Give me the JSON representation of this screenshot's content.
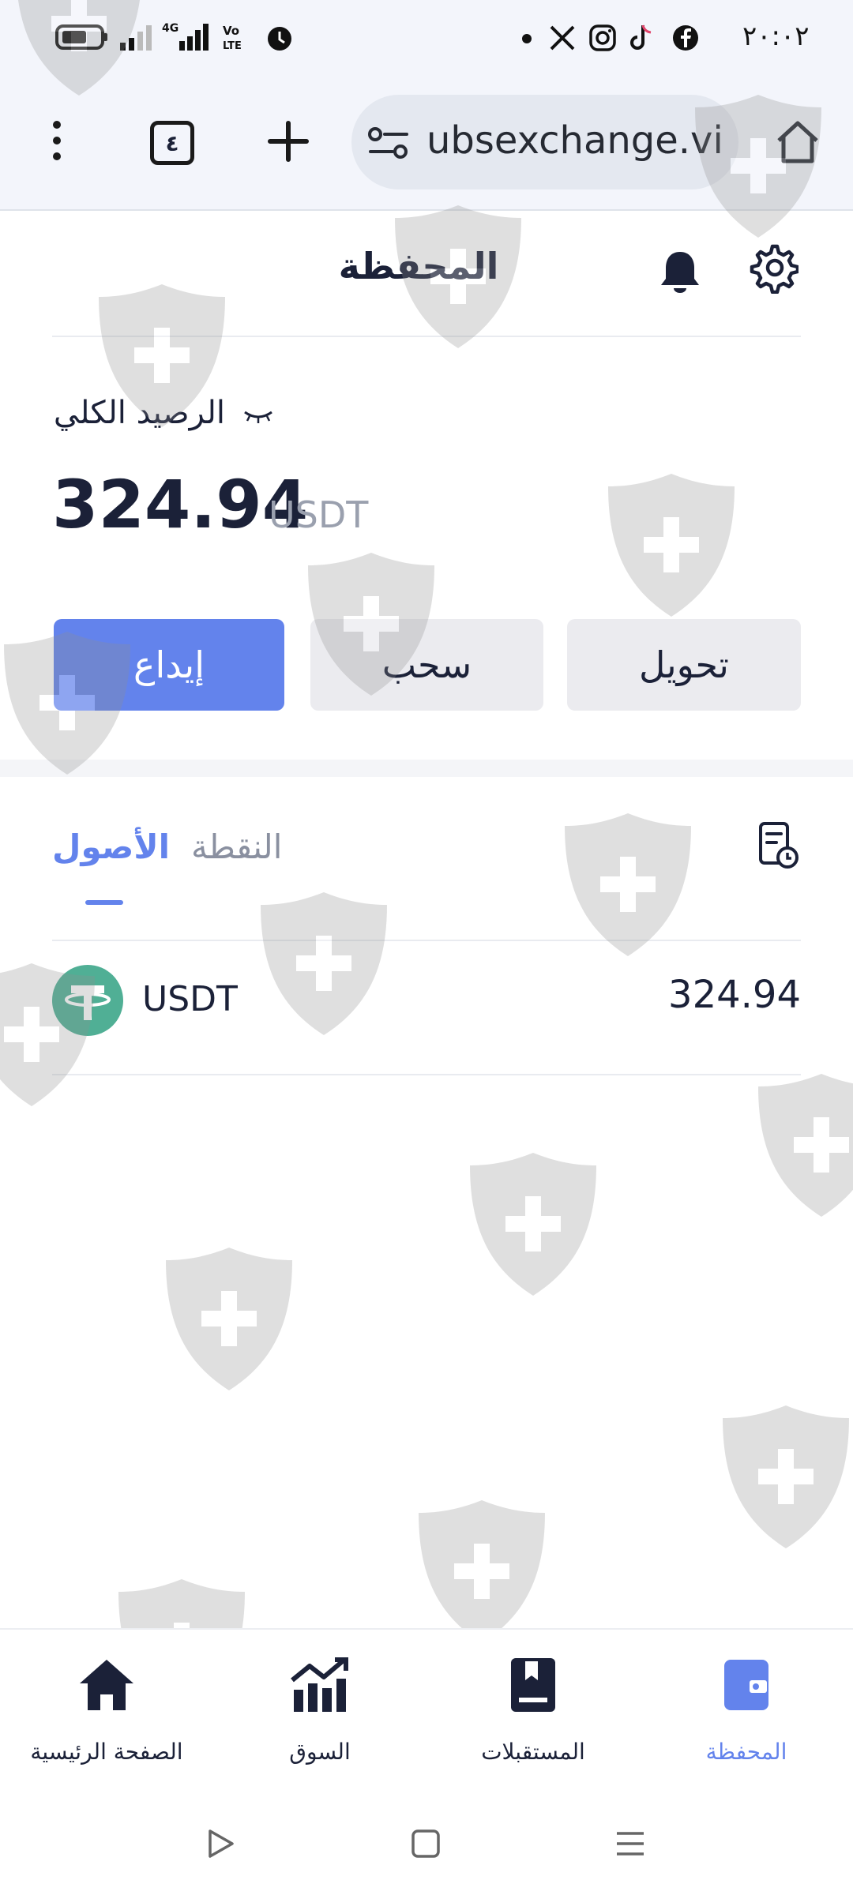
{
  "status_bar": {
    "time": "٢٠:٠٢"
  },
  "browser": {
    "url": "ubsexchange.vip/",
    "tab_count": "٤"
  },
  "header": {
    "title": "المحفظة"
  },
  "balance": {
    "label": "الرصيد الكلي",
    "amount": "324.94",
    "currency": "USDT"
  },
  "actions": {
    "deposit": "إيداع",
    "withdraw": "سحب",
    "transfer": "تحويل"
  },
  "tabs": [
    {
      "label": "الأصول",
      "active": true
    },
    {
      "label": "النقطة",
      "active": false
    }
  ],
  "assets": [
    {
      "symbol": "USDT",
      "balance": "324.94",
      "icon": "tether-icon",
      "color": "#50af95"
    }
  ],
  "bottom_nav": [
    {
      "label": "الصفحة الرئيسية",
      "icon": "home-icon",
      "active": false
    },
    {
      "label": "السوق",
      "icon": "market-chart-icon",
      "active": false
    },
    {
      "label": "المستقبلات",
      "icon": "futures-book-icon",
      "active": false
    },
    {
      "label": "المحفظة",
      "icon": "wallet-icon",
      "active": true
    }
  ],
  "colors": {
    "accent": "#6383ec",
    "text": "#1b2138",
    "muted": "#9aa0ae",
    "button_bg": "#ebebef"
  }
}
